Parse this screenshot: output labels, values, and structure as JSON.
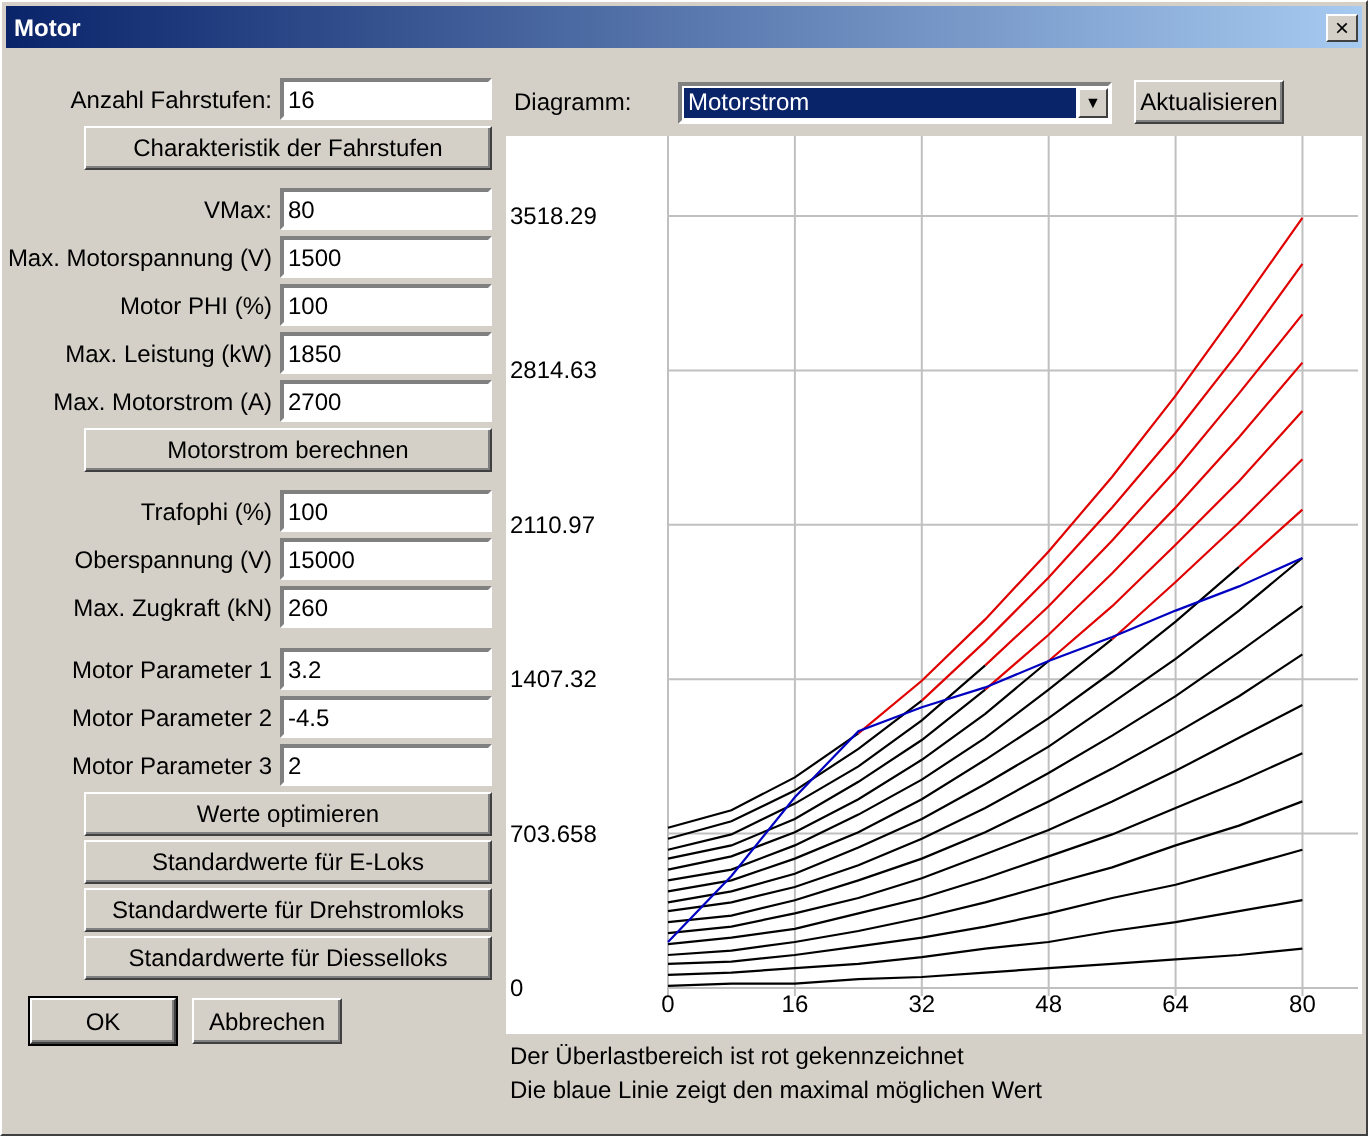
{
  "window": {
    "title": "Motor",
    "close": "×"
  },
  "left_panel": {
    "sections": [
      {
        "items": [
          {
            "kind": "field",
            "label": "Anzahl Fahrstufen:",
            "value": "16"
          },
          {
            "kind": "button",
            "label": "Charakteristik der Fahrstufen"
          }
        ]
      },
      {
        "items": [
          {
            "kind": "field",
            "label": "VMax:",
            "value": "80"
          },
          {
            "kind": "field",
            "label": "Max. Motorspannung (V)",
            "value": "1500"
          },
          {
            "kind": "field",
            "label": "Motor PHI (%)",
            "value": "100"
          },
          {
            "kind": "field",
            "label": "Max. Leistung (kW)",
            "value": "1850"
          },
          {
            "kind": "field",
            "label": "Max. Motorstrom (A)",
            "value": "2700"
          },
          {
            "kind": "button",
            "label": "Motorstrom berechnen"
          }
        ]
      },
      {
        "items": [
          {
            "kind": "field",
            "label": "Trafophi (%)",
            "value": "100"
          },
          {
            "kind": "field",
            "label": "Oberspannung (V)",
            "value": "15000"
          },
          {
            "kind": "field",
            "label": "Max. Zugkraft (kN)",
            "value": "260"
          }
        ]
      },
      {
        "items": [
          {
            "kind": "field",
            "label": "Motor Parameter 1",
            "value": "3.2"
          },
          {
            "kind": "field",
            "label": "Motor Parameter 2",
            "value": "-4.5"
          },
          {
            "kind": "field",
            "label": "Motor Parameter 3",
            "value": "2"
          },
          {
            "kind": "button",
            "label": "Werte optimieren"
          },
          {
            "kind": "button",
            "label": "Standardwerte für E-Loks"
          },
          {
            "kind": "button",
            "label": "Standardwerte für Drehstromloks"
          },
          {
            "kind": "button",
            "label": "Standardwerte für Diesselloks"
          }
        ]
      }
    ]
  },
  "dialog_buttons": [
    {
      "label": "OK",
      "default": true
    },
    {
      "label": "Abbrechen",
      "default": false
    }
  ],
  "diagram": {
    "label": "Diagramm:",
    "selection": "Motorstrom",
    "dropdown_arrow": "▼",
    "refresh_button": "Aktualisieren",
    "chart_data": {
      "type": "line",
      "grid": true,
      "x": [
        0,
        8,
        16,
        24,
        32,
        40,
        48,
        56,
        64,
        72,
        80
      ],
      "xlim": [
        0,
        87
      ],
      "ylim": [
        0,
        3518.29
      ],
      "xticks": [
        0,
        16,
        32,
        48,
        64,
        80
      ],
      "yticks": [
        {
          "value": 0,
          "label": "0"
        },
        {
          "value": 703.658,
          "label": "703.658"
        },
        {
          "value": 1407.32,
          "label": "1407.32"
        },
        {
          "value": 2110.97,
          "label": "2110.97"
        },
        {
          "value": 2814.63,
          "label": "2814.63"
        },
        {
          "value": 3518.29,
          "label": "3518.29"
        }
      ],
      "series": [
        {
          "color": "#000000",
          "values": [
            10,
            20,
            20,
            40,
            50,
            70,
            90,
            110,
            130,
            150,
            180
          ]
        },
        {
          "color": "#000000",
          "values": [
            60,
            70,
            90,
            110,
            140,
            180,
            210,
            260,
            300,
            350,
            400
          ]
        },
        {
          "color": "#000000",
          "values": [
            110,
            120,
            150,
            190,
            230,
            280,
            340,
            410,
            470,
            550,
            630
          ]
        },
        {
          "color": "#000000",
          "values": [
            150,
            170,
            210,
            260,
            320,
            390,
            470,
            550,
            650,
            740,
            850
          ]
        },
        {
          "color": "#000000",
          "values": [
            200,
            230,
            270,
            340,
            410,
            500,
            600,
            700,
            820,
            940,
            1070
          ]
        },
        {
          "color": "#000000",
          "values": [
            250,
            280,
            340,
            410,
            500,
            610,
            720,
            850,
            990,
            1140,
            1290
          ]
        },
        {
          "color": "#000000",
          "values": [
            300,
            330,
            400,
            490,
            590,
            710,
            850,
            1000,
            1160,
            1330,
            1520
          ]
        },
        {
          "color": "#000000",
          "values": [
            350,
            390,
            460,
            560,
            680,
            820,
            980,
            1150,
            1330,
            1530,
            1740
          ]
        },
        {
          "color": "#000000",
          "values": [
            390,
            440,
            520,
            640,
            770,
            930,
            1100,
            1300,
            1500,
            1720,
            1960
          ]
        },
        {
          "color": "#000000",
          "values": [
            440,
            490,
            590,
            710,
            860,
            1040,
            1230,
            1440,
            1670,
            1920,
            null
          ]
        },
        {
          "color": "#e00000",
          "values": [
            null,
            null,
            null,
            null,
            null,
            null,
            null,
            null,
            null,
            1920,
            2180
          ]
        },
        {
          "color": "#000000",
          "values": [
            490,
            540,
            650,
            790,
            950,
            1140,
            1360,
            1590,
            null,
            null,
            null
          ]
        },
        {
          "color": "#e00000",
          "values": [
            null,
            null,
            null,
            null,
            null,
            null,
            null,
            1590,
            1850,
            2120,
            2410
          ]
        },
        {
          "color": "#000000",
          "values": [
            540,
            600,
            710,
            860,
            1040,
            1250,
            1490,
            null,
            null,
            null,
            null
          ]
        },
        {
          "color": "#e00000",
          "values": [
            null,
            null,
            null,
            null,
            null,
            null,
            1490,
            1740,
            2020,
            2310,
            2630
          ]
        },
        {
          "color": "#000000",
          "values": [
            590,
            650,
            770,
            940,
            1130,
            1360,
            null,
            null,
            null,
            null,
            null
          ]
        },
        {
          "color": "#e00000",
          "values": [
            null,
            null,
            null,
            null,
            null,
            1360,
            1610,
            1890,
            2190,
            2510,
            2850
          ]
        },
        {
          "color": "#000000",
          "values": [
            630,
            700,
            840,
            1010,
            1220,
            1470,
            null,
            null,
            null,
            null,
            null
          ]
        },
        {
          "color": "#e00000",
          "values": [
            null,
            null,
            null,
            null,
            null,
            1470,
            1740,
            2040,
            2360,
            2710,
            3070
          ]
        },
        {
          "color": "#000000",
          "values": [
            680,
            760,
            900,
            1090,
            1310,
            null,
            null,
            null,
            null,
            null,
            null
          ]
        },
        {
          "color": "#e00000",
          "values": [
            null,
            null,
            null,
            null,
            1310,
            1580,
            1870,
            2190,
            2530,
            2900,
            3300
          ]
        },
        {
          "color": "#000000",
          "values": [
            730,
            810,
            960,
            1160,
            null,
            null,
            null,
            null,
            null,
            null,
            null
          ]
        },
        {
          "color": "#e00000",
          "values": [
            null,
            null,
            null,
            1160,
            1400,
            1680,
            1990,
            2330,
            2700,
            3100,
            3510
          ]
        },
        {
          "color": "#0000c0",
          "values": [
            210,
            510,
            870,
            1170,
            1280,
            1370,
            1490,
            1600,
            1720,
            1830,
            1960
          ]
        }
      ]
    },
    "notes": [
      "Der Überlastbereich ist rot gekennzeichnet",
      "Die blaue Linie zeigt den maximal möglichen Wert"
    ]
  }
}
